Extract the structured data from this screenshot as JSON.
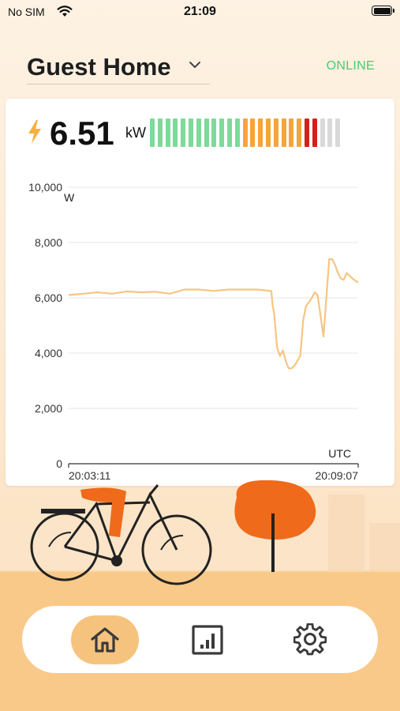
{
  "status_bar": {
    "carrier": "No SIM",
    "time": "21:09"
  },
  "header": {
    "home_name": "Guest Home",
    "connection_status": "ONLINE"
  },
  "power": {
    "value": "6.51",
    "unit": "kW",
    "level_segments": [
      "green",
      "green",
      "green",
      "green",
      "green",
      "green",
      "green",
      "green",
      "green",
      "green",
      "green",
      "green",
      "orange",
      "orange",
      "orange",
      "orange",
      "orange",
      "orange",
      "orange",
      "orange",
      "red",
      "red",
      "gray",
      "gray",
      "gray"
    ]
  },
  "chart_data": {
    "type": "line",
    "ylabel": "W",
    "timezone_label": "UTC",
    "ylim": [
      0,
      10000
    ],
    "yticks": [
      "10,000",
      "8,000",
      "6,000",
      "4,000",
      "2,000",
      "0"
    ],
    "xticks": [
      "20:03:11",
      "20:09:07"
    ],
    "grid": true,
    "series": [
      {
        "color": "#f6c583",
        "x": [
          0,
          5,
          10,
          15,
          20,
          25,
          30,
          35,
          40,
          45,
          50,
          55,
          60,
          65,
          70,
          70.5,
          71,
          72,
          73,
          74,
          75,
          76,
          77,
          78,
          80,
          81,
          82,
          84,
          85,
          86,
          88,
          90,
          91,
          92,
          93,
          94,
          95,
          96,
          97,
          98,
          100
        ],
        "y": [
          6100,
          6150,
          6200,
          6150,
          6230,
          6200,
          6220,
          6150,
          6300,
          6300,
          6250,
          6300,
          6300,
          6300,
          6250,
          5700,
          5400,
          4200,
          3900,
          4100,
          3700,
          3450,
          3450,
          3550,
          3900,
          5200,
          5700,
          6000,
          6200,
          6100,
          4600,
          7400,
          7400,
          7200,
          6900,
          6700,
          6650,
          6900,
          6800,
          6700,
          6550
        ]
      }
    ]
  },
  "nav": {
    "tabs": [
      {
        "icon": "home-icon",
        "active": true
      },
      {
        "icon": "stats-icon",
        "active": false
      },
      {
        "icon": "settings-icon",
        "active": false
      }
    ]
  },
  "colors": {
    "accent": "#f6c37e",
    "online": "#4cc96c",
    "level_green": "#7fd99a",
    "level_orange": "#f4a53a",
    "level_red": "#d4201b",
    "level_gray": "#d9d9d9",
    "line": "#f6c583"
  }
}
